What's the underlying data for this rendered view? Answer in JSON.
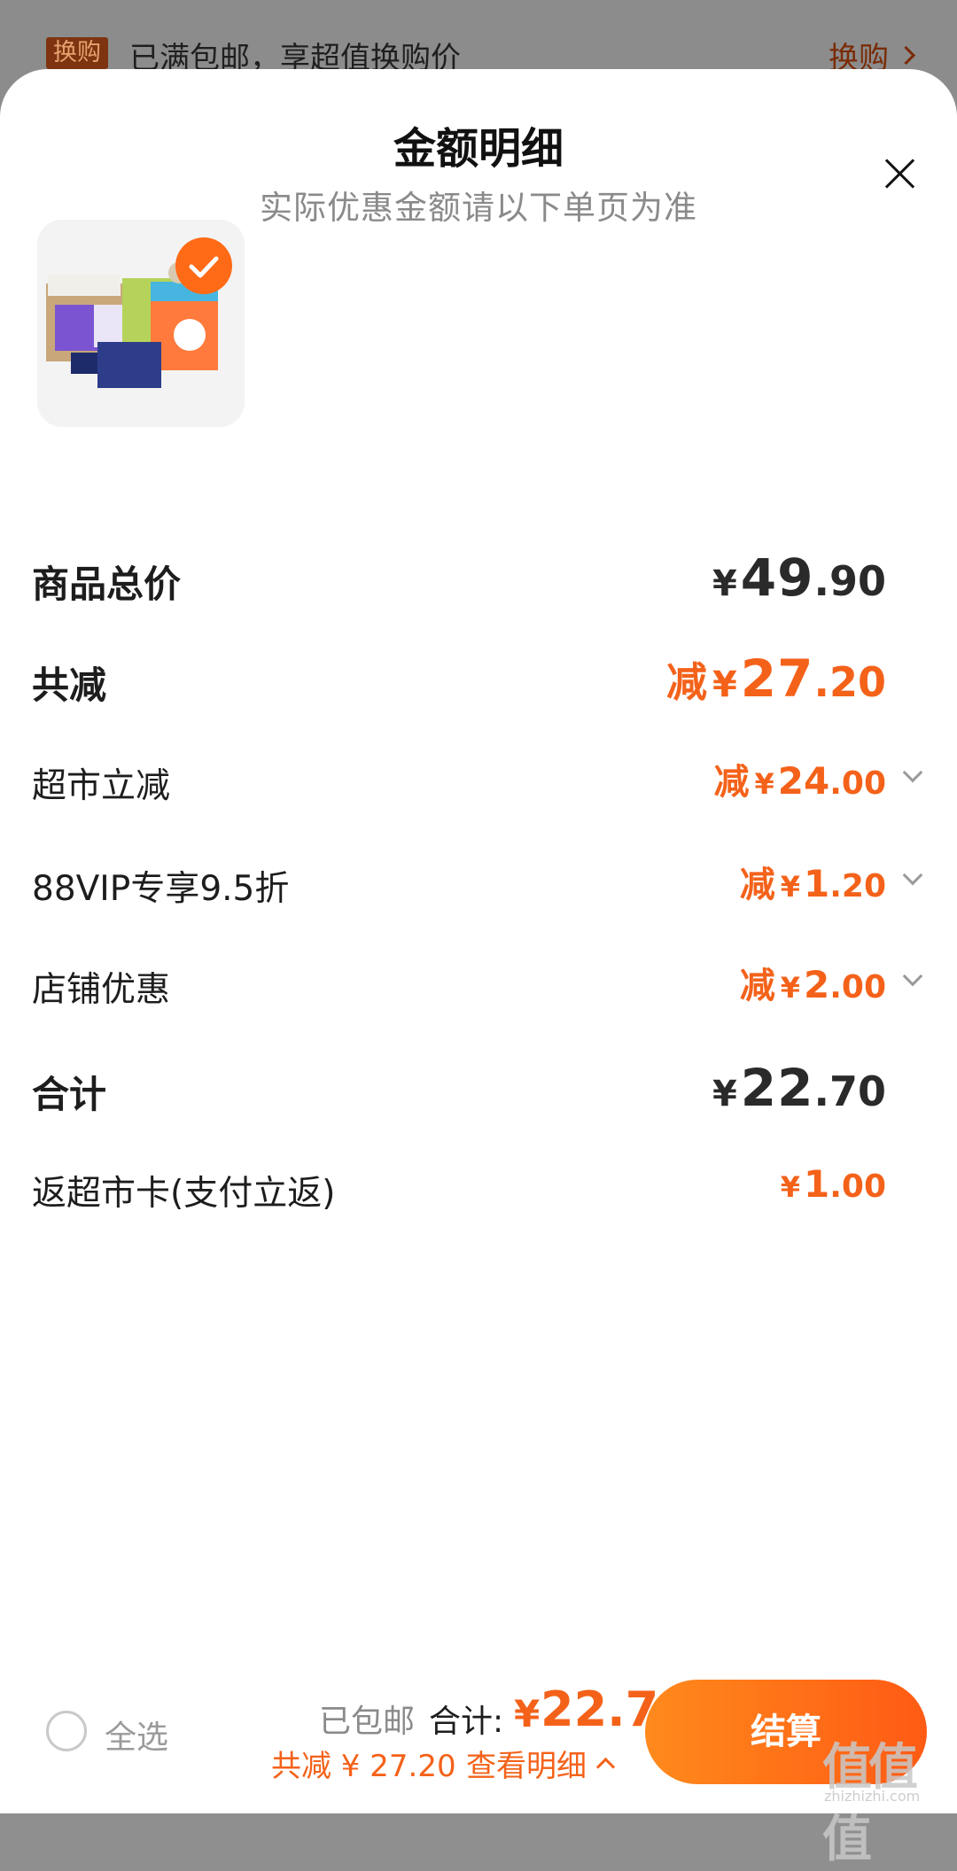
{
  "banner": {
    "tag": "换购",
    "text": "已满包邮，享超值换购价",
    "action": "换购"
  },
  "sheet": {
    "title": "金额明细",
    "subtitle": "实际优惠金额请以下单页为准"
  },
  "rows": {
    "goods_total": {
      "label": "商品总价",
      "yen": "¥",
      "int": "49",
      "frac": ".90"
    },
    "total_reduce": {
      "label": "共减",
      "prefix": "减",
      "yen": "¥",
      "int": "27",
      "frac": ".20"
    },
    "supermarket": {
      "label": "超市立减",
      "prefix": "减",
      "yen": "¥",
      "int": "24",
      "frac": ".00"
    },
    "vip": {
      "label": "88VIP专享9.5折",
      "prefix": "减",
      "yen": "¥",
      "int": "1",
      "frac": ".20"
    },
    "store": {
      "label": "店铺优惠",
      "prefix": "减",
      "yen": "¥",
      "int": "2",
      "frac": ".00"
    },
    "sum": {
      "label": "合计",
      "yen": "¥",
      "int": "22",
      "frac": ".70"
    },
    "card_back": {
      "label": "返超市卡(支付立返)",
      "yen": "¥",
      "int": "1",
      "frac": ".00"
    }
  },
  "bottom": {
    "select_all": "全选",
    "shipping": "已包邮",
    "total_label": "合计:",
    "total_yen": "¥",
    "total_amount": "22.7",
    "total_reduce": "共减 ¥ 27.20",
    "view_detail": "查看明细",
    "checkout": "结算"
  },
  "watermark": {
    "main": "值值值",
    "sub": "zhizhizhi.com"
  },
  "colors": {
    "accent": "#f4621a",
    "text": "#1d1d1d",
    "muted": "#8a8a8a"
  }
}
